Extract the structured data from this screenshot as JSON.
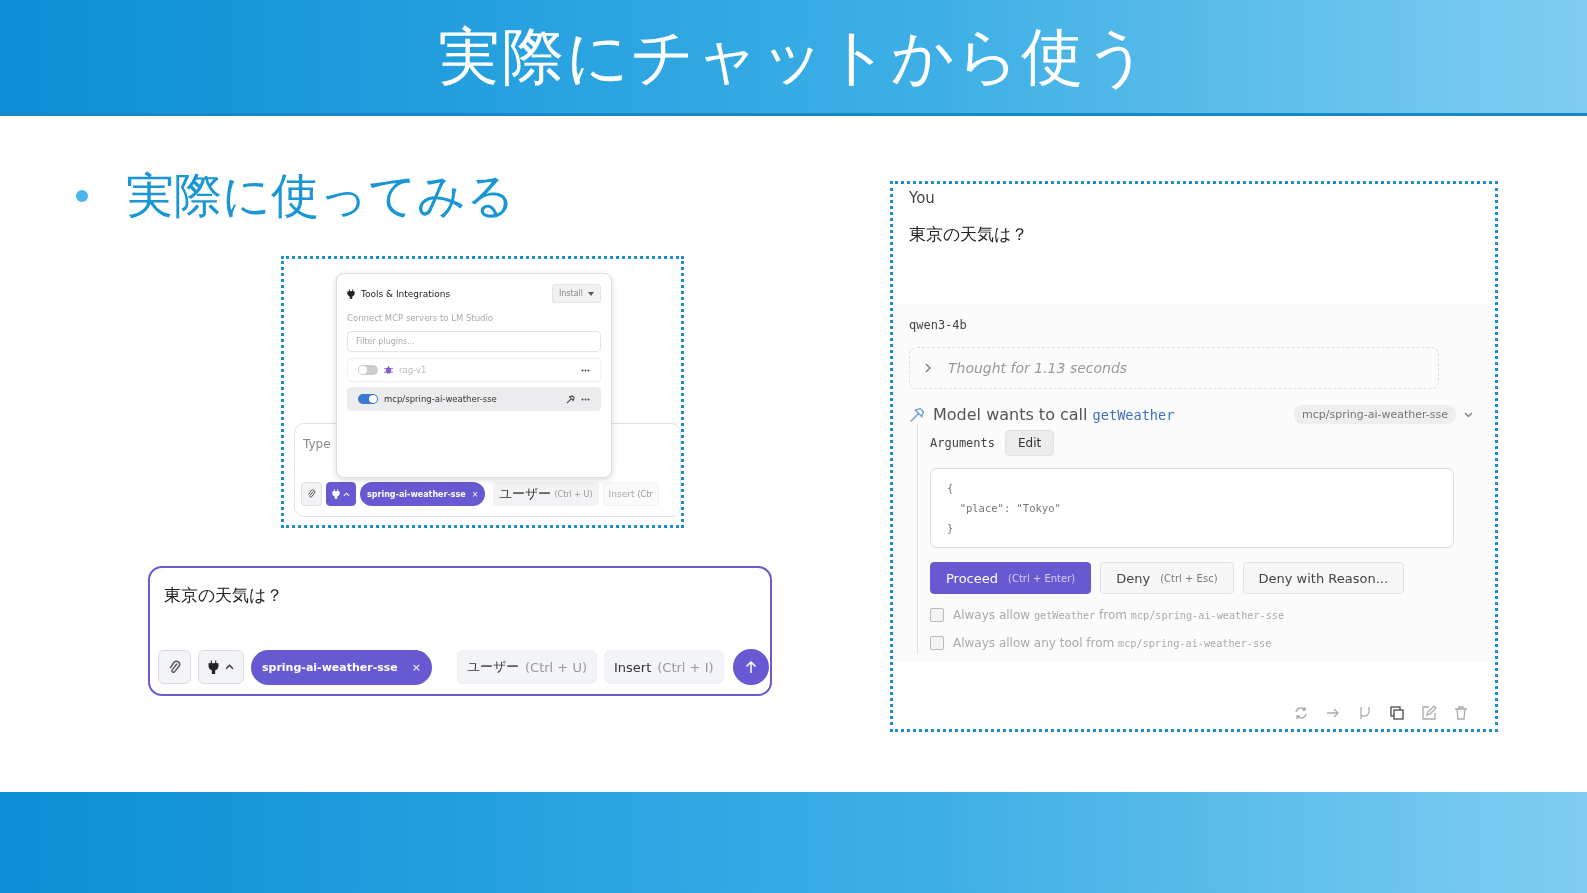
{
  "slide": {
    "title": "実際にチャットから使う",
    "bullet": "実際に使ってみる"
  },
  "tools_popup": {
    "title": "Tools & Integrations",
    "install": "Install",
    "subtitle": "Connect MCP servers to LM Studio",
    "filter_placeholder": "Filter plugins...",
    "plugins": [
      {
        "name": "rag-v1",
        "on": false,
        "highlighted": false
      },
      {
        "name": "mcp/spring-ai-weather-sse",
        "on": true,
        "highlighted": true
      }
    ]
  },
  "small_input": {
    "placeholder": "Type",
    "chip": {
      "label": "spring-ai-weather-sse",
      "close": "×"
    },
    "role_button": {
      "label": "ユーザー",
      "shortcut": "(Ctrl + U)"
    },
    "insert_button": {
      "label": "Insert",
      "shortcut": "(Ctr"
    }
  },
  "chat_input": {
    "value": "東京の天気は？",
    "chip": {
      "label": "spring-ai-weather-sse",
      "close": "×"
    },
    "role_button": {
      "label": "ユーザー",
      "shortcut": "(Ctrl + U)"
    },
    "insert_button": {
      "label": "Insert",
      "shortcut": "(Ctrl + I)"
    }
  },
  "conversation": {
    "user_label": "You",
    "user_message": "東京の天気は？",
    "model": "qwen3-4b",
    "thought": "Thought for 1.13 seconds",
    "thought_expanded": false,
    "tool_call": {
      "parts": [
        {
          "text": "Model wants to call ",
          "kind": "plain"
        },
        {
          "text": "getWeather",
          "kind": "code"
        }
      ],
      "server": "mcp/spring-ai-weather-sse",
      "arguments_label": "Arguments",
      "edit": "Edit",
      "arguments": [
        "{",
        "  \"place\": \"Tokyo\"",
        "}"
      ],
      "buttons": [
        {
          "label": "Proceed",
          "shortcut": "(Ctrl + Enter)",
          "kind": "primary"
        },
        {
          "label": "Deny",
          "shortcut": "(Ctrl + Esc)",
          "kind": "secondary"
        },
        {
          "label": "Deny with Reason...",
          "kind": "secondary"
        }
      ],
      "options": [
        {
          "checked": false,
          "parts": [
            {
              "text": "Always allow ",
              "kind": "plain"
            },
            {
              "text": "getWeather",
              "kind": "code"
            },
            {
              "text": " from ",
              "kind": "plain"
            },
            {
              "text": "mcp/spring-ai-weather-sse",
              "kind": "code"
            }
          ]
        },
        {
          "checked": false,
          "parts": [
            {
              "text": "Always allow any tool from ",
              "kind": "plain"
            },
            {
              "text": "mcp/spring-ai-weather-sse",
              "kind": "code"
            }
          ]
        }
      ]
    }
  }
}
